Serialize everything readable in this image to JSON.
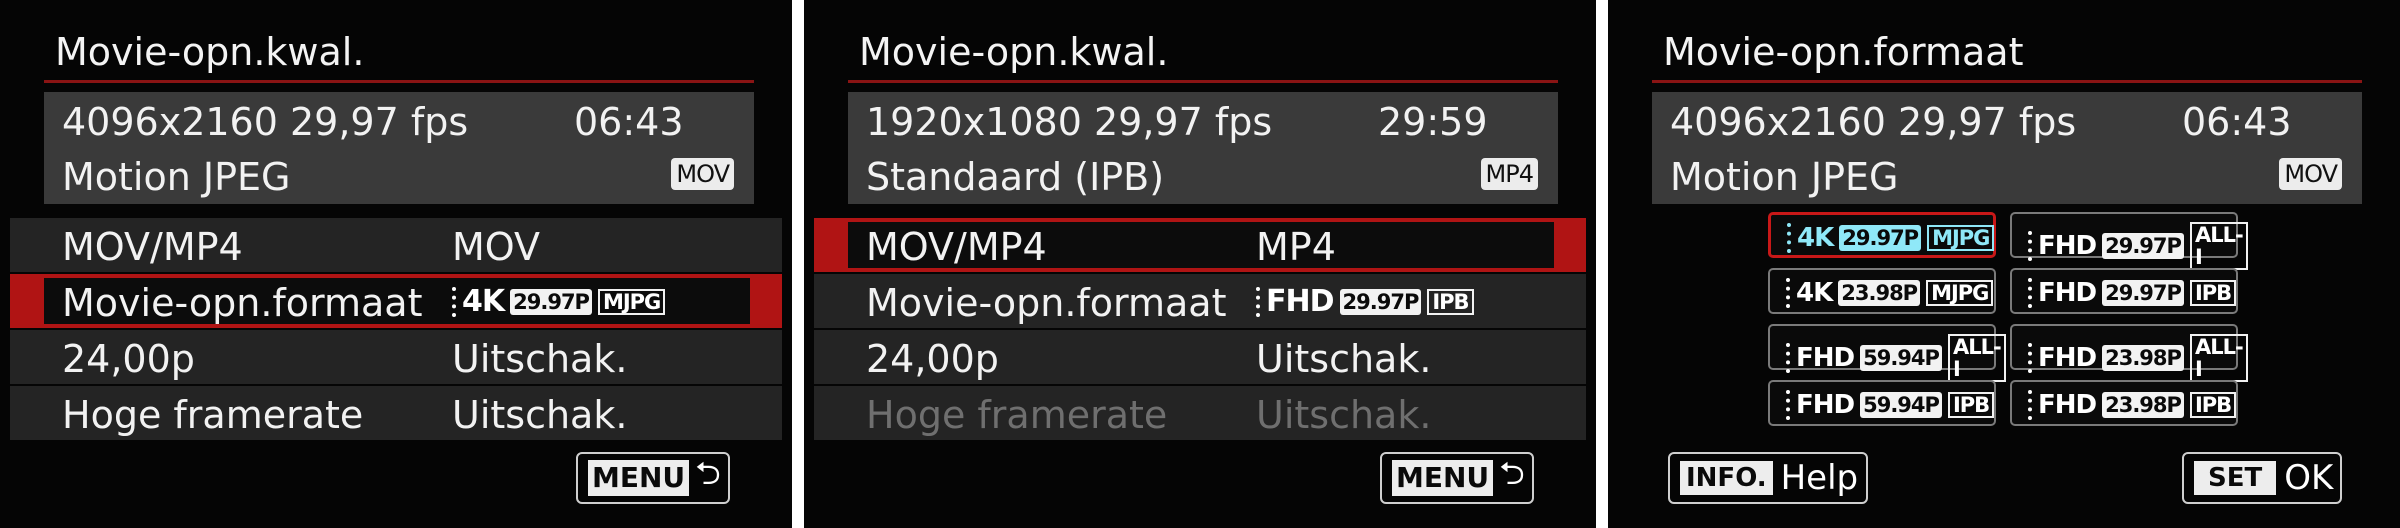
{
  "screens": [
    {
      "title": "Movie-opn.kwal.",
      "info": {
        "resolution": "4096x2160 29,97 fps",
        "time": "06:43",
        "compression": "Motion JPEG",
        "container": "MOV"
      },
      "rows": [
        {
          "label": "MOV/MP4",
          "value": "MOV"
        },
        {
          "label": "Movie-opn.formaat",
          "format": {
            "res": "4K",
            "rate": "29.97P",
            "codec": "MJPG"
          }
        },
        {
          "label": "24,00p",
          "value": "Uitschak."
        },
        {
          "label": "Hoge framerate",
          "value": "Uitschak."
        }
      ],
      "menu_button": "MENU"
    },
    {
      "title": "Movie-opn.kwal.",
      "info": {
        "resolution": "1920x1080 29,97 fps",
        "time": "29:59",
        "compression": "Standaard (IPB)",
        "container": "MP4"
      },
      "rows": [
        {
          "label": "MOV/MP4",
          "value": "MP4"
        },
        {
          "label": "Movie-opn.formaat",
          "format": {
            "res": "FHD",
            "rate": "29.97P",
            "codec": "IPB"
          }
        },
        {
          "label": "24,00p",
          "value": "Uitschak."
        },
        {
          "label": "Hoge framerate",
          "value": "Uitschak."
        }
      ],
      "menu_button": "MENU"
    },
    {
      "title": "Movie-opn.formaat",
      "info": {
        "resolution": "4096x2160 29,97 fps",
        "time": "06:43",
        "compression": "Motion JPEG",
        "container": "MOV"
      },
      "formats": [
        {
          "res": "4K",
          "rate": "29.97P",
          "codec": "MJPG"
        },
        {
          "res": "FHD",
          "rate": "29.97P",
          "codec": "ALL-I"
        },
        {
          "res": "4K",
          "rate": "23.98P",
          "codec": "MJPG"
        },
        {
          "res": "FHD",
          "rate": "29.97P",
          "codec": "IPB"
        },
        {
          "res": "FHD",
          "rate": "59.94P",
          "codec": "ALL-I"
        },
        {
          "res": "FHD",
          "rate": "23.98P",
          "codec": "ALL-I"
        },
        {
          "res": "FHD",
          "rate": "59.94P",
          "codec": "IPB"
        },
        {
          "res": "FHD",
          "rate": "23.98P",
          "codec": "IPB"
        }
      ],
      "info_button": "INFO.",
      "help_label": "Help",
      "set_button": "SET",
      "ok_label": "OK"
    }
  ],
  "colors": {
    "highlight": "#b01414",
    "rule": "#8a1414",
    "selected_format": "#8fe8f8"
  }
}
